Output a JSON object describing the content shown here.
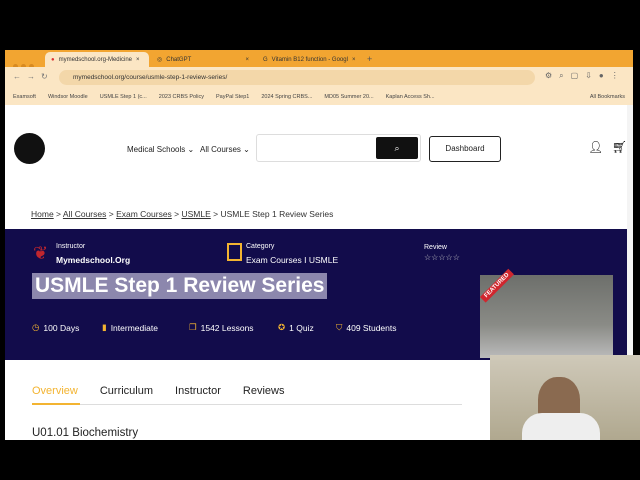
{
  "browser": {
    "tabs": [
      "mymedschool.org-Medicine",
      "ChatGPT",
      "Vitamin B12 function - Googl"
    ],
    "url": "mymedschool.org/course/usmle-step-1-review-series/",
    "bookmarks": [
      "Examsoft",
      "Windsor Moodle",
      "USMLE Step 1 (c...",
      "2023 CRBS Policy",
      "PayPal Step1",
      "2024 Spring CRBS...",
      "MD05 Summer 20...",
      "Kaplan Access Sh..."
    ],
    "all_bookmarks": "All Bookmarks"
  },
  "header": {
    "nav": [
      "Medical Schools",
      "All Courses"
    ],
    "search_placeholder": "",
    "dashboard": "Dashboard"
  },
  "breadcrumb": [
    "Home",
    "All Courses",
    "Exam Courses",
    "USMLE",
    "USMLE Step 1 Review Series"
  ],
  "banner": {
    "instructor_label": "Instructor",
    "instructor": "Mymedschool.Org",
    "category_label": "Category",
    "category": "Exam Courses I USMLE",
    "review_label": "Review",
    "rating_stars": 0,
    "title": "USMLE Step 1 Review Series",
    "stats": [
      "100 Days",
      "Intermediate",
      "1542 Lessons",
      "1 Quiz",
      "409 Students"
    ],
    "featured": "FEATURED"
  },
  "tabs": [
    "Overview",
    "Curriculum",
    "Instructor",
    "Reviews"
  ],
  "section": "U01.01 Biochemistry",
  "colors": {
    "banner": "#120c4b",
    "accent": "#f3b431",
    "chrome": "#f2a531"
  }
}
